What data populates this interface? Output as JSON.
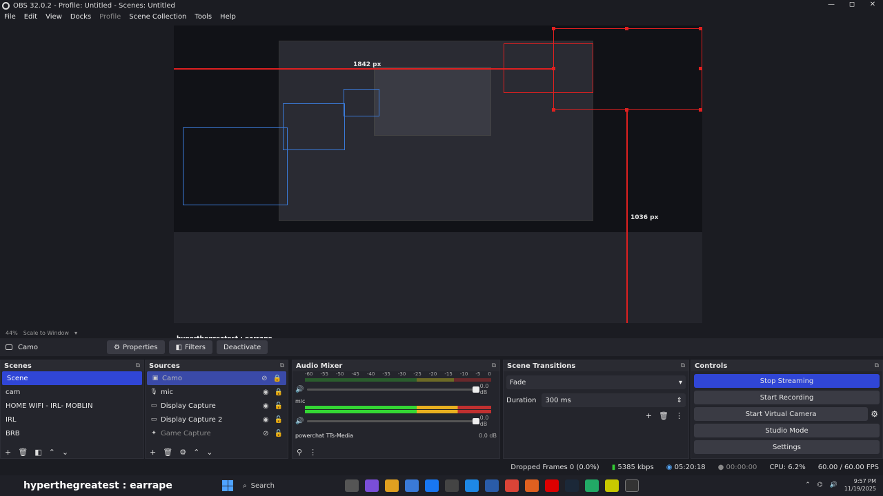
{
  "window": {
    "title": "OBS 32.0.2 - Profile: Untitled - Scenes: Untitled",
    "min": "—",
    "max": "◻",
    "close": "✕"
  },
  "menu": [
    "File",
    "Edit",
    "View",
    "Docks",
    "Profile",
    "Scene Collection",
    "Tools",
    "Help"
  ],
  "preview": {
    "width_label": "1842 px",
    "height_label": "1036 px",
    "overlay_text": "hyperthegreatest : earrape"
  },
  "zoom": {
    "level": "44%",
    "mode": "Scale to Window"
  },
  "source_bar": {
    "source_name": "Camo",
    "properties": "Properties",
    "filters": "Filters",
    "deactivate": "Deactivate"
  },
  "scenes": {
    "title": "Scenes",
    "items": [
      "Scene",
      "cam",
      "HOME WIFI - IRL- MOBLIN",
      "IRL",
      "BRB"
    ]
  },
  "sources": {
    "title": "Sources",
    "items": [
      "Camo",
      "mic",
      "Display Capture",
      "Display Capture 2",
      "Game Capture"
    ]
  },
  "mixer": {
    "title": "Audio Mixer",
    "scale": [
      "-60",
      "-55",
      "-50",
      "-45",
      "-40",
      "-35",
      "-30",
      "-25",
      "-20",
      "-15",
      "-10",
      "-5",
      "0"
    ],
    "channels": [
      {
        "name": "",
        "db": "0.0 dB"
      },
      {
        "name": "mic",
        "db": "0.0 dB"
      }
    ],
    "third_channel": {
      "name": "powerchat TTs-Media",
      "db": "0.0 dB"
    }
  },
  "transitions": {
    "title": "Scene Transitions",
    "type": "Fade",
    "duration_label": "Duration",
    "duration": "300 ms"
  },
  "controls": {
    "title": "Controls",
    "buttons": [
      "Stop Streaming",
      "Start Recording",
      "Start Virtual Camera",
      "Studio Mode",
      "Settings"
    ]
  },
  "status": {
    "dropped": "Dropped Frames 0 (0.0%)",
    "bitrate": "5385 kbps",
    "stream_time": "05:20:18",
    "rec_time": "00:00:00",
    "cpu": "CPU: 6.2%",
    "fps": "60.00 / 60.00 FPS"
  },
  "taskbar": {
    "ticker": "hyperthegreatest : earrape",
    "search": "Search",
    "time": "9:57 PM",
    "date": "11/19/2025"
  },
  "colors": {
    "accent": "#3046d6",
    "red_guide": "#e02020",
    "blue_guide": "#3a7ad8"
  }
}
